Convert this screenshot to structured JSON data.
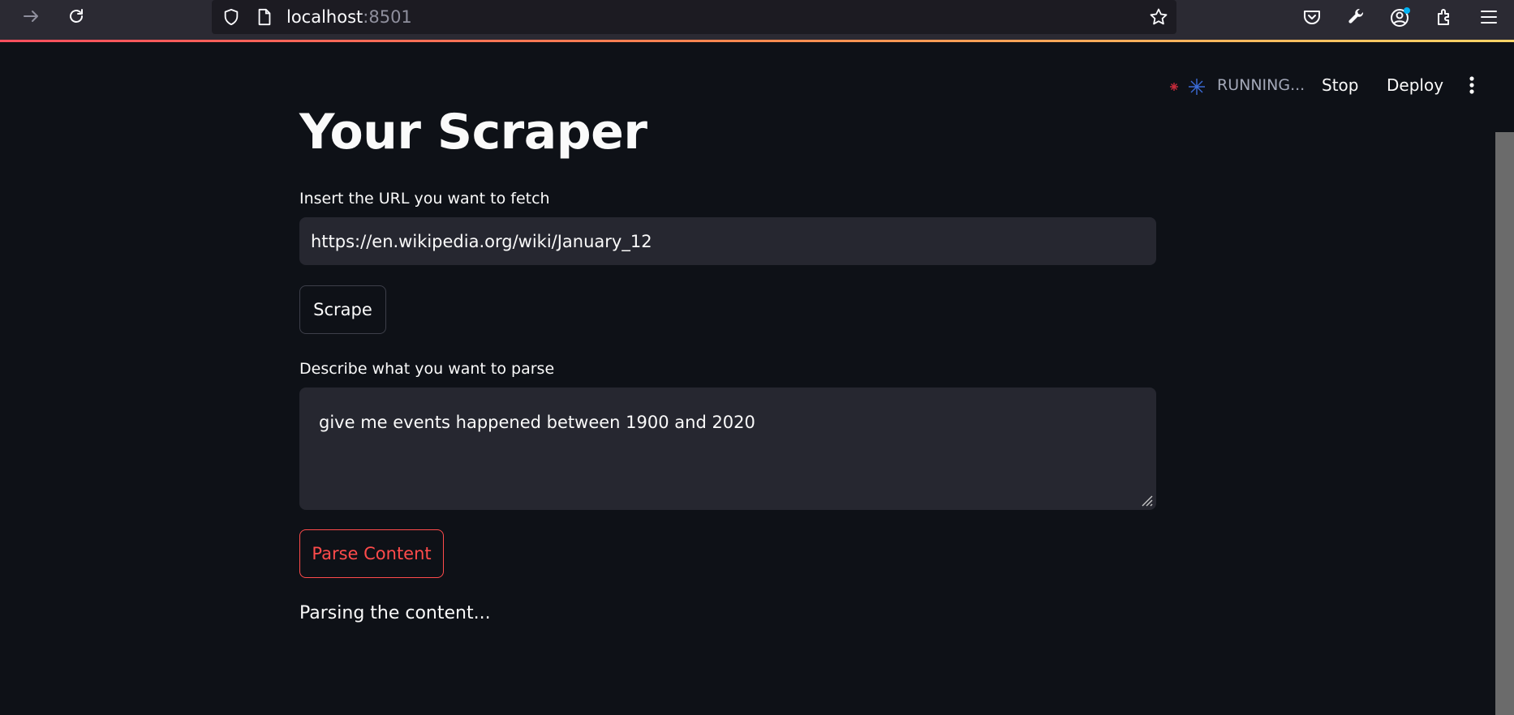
{
  "browser": {
    "url_host": "localhost",
    "url_port": ":8501",
    "icons": {
      "back": "arrow-right-icon",
      "reload": "reload-icon",
      "shield": "shield-icon",
      "page": "page-icon",
      "bookmark": "star-icon",
      "pocket": "pocket-icon",
      "tools": "wrench-icon",
      "account": "account-icon",
      "extensions": "puzzle-icon",
      "menu": "hamburger-icon"
    }
  },
  "app_header": {
    "status": "RUNNING...",
    "stop_label": "Stop",
    "deploy_label": "Deploy",
    "menu_icon": "kebab-icon"
  },
  "main": {
    "title": "Your Scraper",
    "url_field": {
      "label": "Insert the URL you want to fetch",
      "value": "https://en.wikipedia.org/wiki/January_12"
    },
    "scrape_button": "Scrape",
    "parse_field": {
      "label": "Describe what you want to parse",
      "value": "give me events happened between 1900 and 2020"
    },
    "parse_button": "Parse Content",
    "status_message": "Parsing the content..."
  },
  "colors": {
    "background": "#0e1117",
    "input_bg": "#262730",
    "accent": "#ff4b4b",
    "text": "#fafafa"
  }
}
